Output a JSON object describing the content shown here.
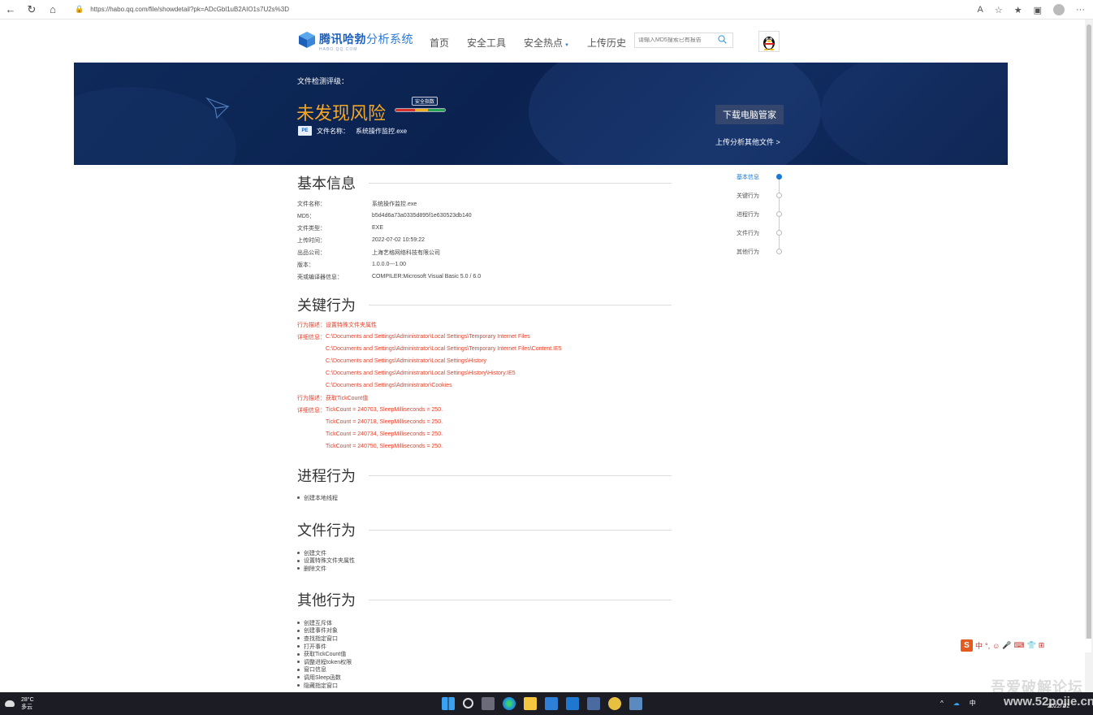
{
  "browser": {
    "url": "https://habo.qq.com/file/showdetail?pk=ADcGbl1uB2AIO1s7U2s%3D"
  },
  "header": {
    "logo_main": "腾讯哈勃",
    "logo_suffix": "分析系统",
    "logo_sub": "HABO.QQ.COM",
    "nav": [
      "首页",
      "安全工具",
      "安全热点",
      "上传历史"
    ],
    "nav_dropdown_icon": "caret-down-icon",
    "search_placeholder": "请输入MD5搜索已有报告"
  },
  "banner": {
    "label": "文件检测评级：",
    "risk_text": "未发现风险",
    "meter_tip": "安全指数",
    "file_label": "文件名称：",
    "file_name": "系统操作监控.exe",
    "download_button": "下载电脑管家",
    "upload_more": "上传分析其他文件 >",
    "colors": {
      "risk": "#f5a623",
      "banner_bg": "#0e2a5a"
    }
  },
  "basic": {
    "title": "基本信息",
    "rows": [
      {
        "k": "文件名称：",
        "v": "系统操作监控.exe"
      },
      {
        "k": "MD5：",
        "v": "b5d4d6a73a0335d895f1e630523db140"
      },
      {
        "k": "文件类型：",
        "v": "EXE"
      },
      {
        "k": "上传时间：",
        "v": "2022-07-02 10:59:22"
      },
      {
        "k": "出品公司：",
        "v": "上海艺格网络科技有限公司"
      },
      {
        "k": "版本：",
        "v": "1.0.0.0---1.00"
      },
      {
        "k": "壳或编译器信息：",
        "v": "COMPILER:Microsoft Visual Basic 5.0 / 6.0"
      }
    ]
  },
  "key": {
    "title": "关键行为",
    "desc_label": "行为描述：",
    "detail_label": "详细信息：",
    "groups": [
      {
        "desc": "设置特殊文件夹属性",
        "details": [
          "C:\\Documents and Settings\\Administrator\\Local Settings\\Temporary Internet Files",
          "C:\\Documents and Settings\\Administrator\\Local Settings\\Temporary Internet Files\\Content.IE5",
          "C:\\Documents and Settings\\Administrator\\Local Settings\\History",
          "C:\\Documents and Settings\\Administrator\\Local Settings\\History\\History.IE5",
          "C:\\Documents and Settings\\Administrator\\Cookies"
        ]
      },
      {
        "desc": "获取TickCount值",
        "details": [
          "TickCount = 240703, SleepMilliseconds = 250.",
          "TickCount = 240718, SleepMilliseconds = 250.",
          "TickCount = 240734, SleepMilliseconds = 250.",
          "TickCount = 240750, SleepMilliseconds = 250."
        ]
      }
    ],
    "color": "#e2412b"
  },
  "process": {
    "title": "进程行为",
    "items": [
      "创建本地线程"
    ]
  },
  "file": {
    "title": "文件行为",
    "items": [
      "创建文件",
      "设置特殊文件夹属性",
      "删除文件"
    ]
  },
  "other": {
    "title": "其他行为",
    "items": [
      "创建互斥体",
      "创建事件对象",
      "查找指定窗口",
      "打开事件",
      "获取TickCount值",
      "调整进程token权限",
      "窗口信息",
      "调用Sleep函数",
      "隐藏指定窗口"
    ]
  },
  "side_nav": [
    "基本信息",
    "关键行为",
    "进程行为",
    "文件行为",
    "其他行为"
  ],
  "ime": {
    "logo": "S",
    "items": [
      "中",
      "°,",
      "☺",
      "🎤",
      "⌨",
      "👕",
      "⊞"
    ]
  },
  "watermark": "吾爱破解论坛",
  "watermark2": "www.52pojie.cn",
  "taskbar": {
    "temp": "28°C",
    "weather": "多云",
    "lang": "中",
    "date": "2022/7/2"
  }
}
